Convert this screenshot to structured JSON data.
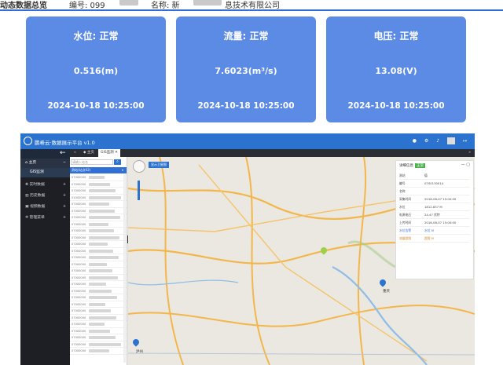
{
  "top": {
    "section_title": "动态数据总览",
    "code_label": "编号: 099",
    "name_label": "名称: 新",
    "name_suffix": "息技术有限公司"
  },
  "cards": [
    {
      "title": "水位: 正常",
      "value": "0.516(m)",
      "time": "2024-10-18 10:25:00"
    },
    {
      "title": "流量: 正常",
      "value": "7.6023(m³/s)",
      "time": "2024-10-18 10:25:00"
    },
    {
      "title": "电压: 正常",
      "value": "13.08(V)",
      "time": "2024-10-18 10:25:00"
    }
  ],
  "app": {
    "title": "鹏希云·数据展示平台 v1.0",
    "header_icons": [
      "search-icon",
      "settings-icon",
      "bell-icon",
      "avatar",
      "exit-icon"
    ],
    "sidebar": {
      "items": [
        {
          "label": "主页",
          "icon": "home-icon"
        },
        {
          "label": "GIS监测"
        },
        {
          "label": "实时数据",
          "icon": "gear-icon"
        },
        {
          "label": "历史数据",
          "icon": "chart-icon"
        },
        {
          "label": "视频数据",
          "icon": "video-icon"
        },
        {
          "label": "管理菜单",
          "icon": "settings-icon"
        }
      ]
    },
    "tabs": [
      "主页",
      "GIS监测"
    ],
    "list": {
      "search_placeholder": "请输入站名",
      "group": "测站(站点02)",
      "rows": [
        "07000000",
        "07000000",
        "07000000",
        "01000000",
        "07000000",
        "07000000",
        "07000000",
        "07000000",
        "07000000",
        "07000000",
        "07000000",
        "07000000",
        "07000000",
        "07000000",
        "07000000",
        "07000000",
        "07000000",
        "07000000",
        "07000000",
        "07000000",
        "07000000",
        "07000000",
        "07000000",
        "07000000",
        "07000000",
        "07000000",
        "07000000"
      ]
    },
    "map": {
      "button": "显示卫星图",
      "city_label": "重庆",
      "city2_label": "泸州",
      "info": {
        "title": "详细信息",
        "badge": "正常",
        "rows": [
          {
            "k": "测站",
            "v": "值"
          },
          {
            "k": "编号",
            "v": "0700130014"
          },
          {
            "k": "名称",
            "v": ""
          },
          {
            "k": "采集时间",
            "v": "2018-08-07 15:00:00"
          },
          {
            "k": "水位",
            "v": "1812.837 M"
          },
          {
            "k": "电源电压",
            "v": "24.47 伏特"
          },
          {
            "k": "上传时间",
            "v": "2018-08-07 15:00:00"
          },
          {
            "k": "水位告警",
            "v": "水位 M"
          },
          {
            "k": "流量超限",
            "v": "超限 M"
          }
        ]
      }
    }
  }
}
